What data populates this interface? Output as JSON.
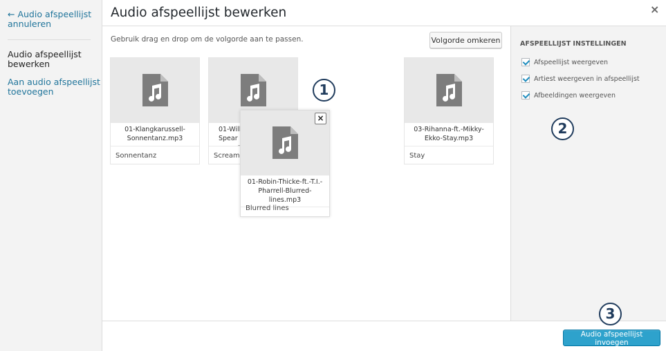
{
  "menu": {
    "cancel_line1": "← Audio afspeellijst",
    "cancel_line2": "annuleren",
    "current_line1": "Audio afspeellijst",
    "current_line2": "bewerken",
    "add_line1": "Aan audio afspeellijst",
    "add_line2": "toevoegen"
  },
  "header": {
    "title": "Audio afspeellijst bewerken",
    "close": "×"
  },
  "content": {
    "instructions": "Gebruik drag en drop om de volgorde aan te passen.",
    "reverse_button": "Volgorde omkeren"
  },
  "cards": [
    {
      "name_line1": "01-Klangkarussell-",
      "name_line2": "Sonnentanz.mp3",
      "caption": "Sonnentanz"
    },
    {
      "name_line1": "01-Will.",
      "name_line2": "Spear",
      "name_line3": "s",
      "caption": "Scream a"
    },
    {
      "name_line1": "03-Rihanna-ft.-Mikky-",
      "name_line2": "Ekko-Stay.mp3",
      "caption": "Stay"
    }
  ],
  "drag_card": {
    "name_line1": "01-Robin-Thicke-ft.-T.I.-",
    "name_line2": "Pharrell-Blurred-",
    "name_line3": "lines.mp3",
    "caption": "Blurred lines",
    "remove": "×"
  },
  "settings": {
    "title": "AFSPEELLIJST INSTELLINGEN",
    "options": [
      {
        "label": "Afspeellijst weergeven",
        "checked": true
      },
      {
        "label": "Artiest weergeven in afspeellijst",
        "checked": true
      },
      {
        "label": "Afbeeldingen weergeven",
        "checked": true
      }
    ]
  },
  "footer": {
    "insert_button": "Audio afspeellijst invoegen"
  },
  "badges": [
    "1",
    "2",
    "3"
  ],
  "colors": {
    "accent": "#2ea2cc",
    "link": "#21759b",
    "badge": "#1f3b5c"
  }
}
